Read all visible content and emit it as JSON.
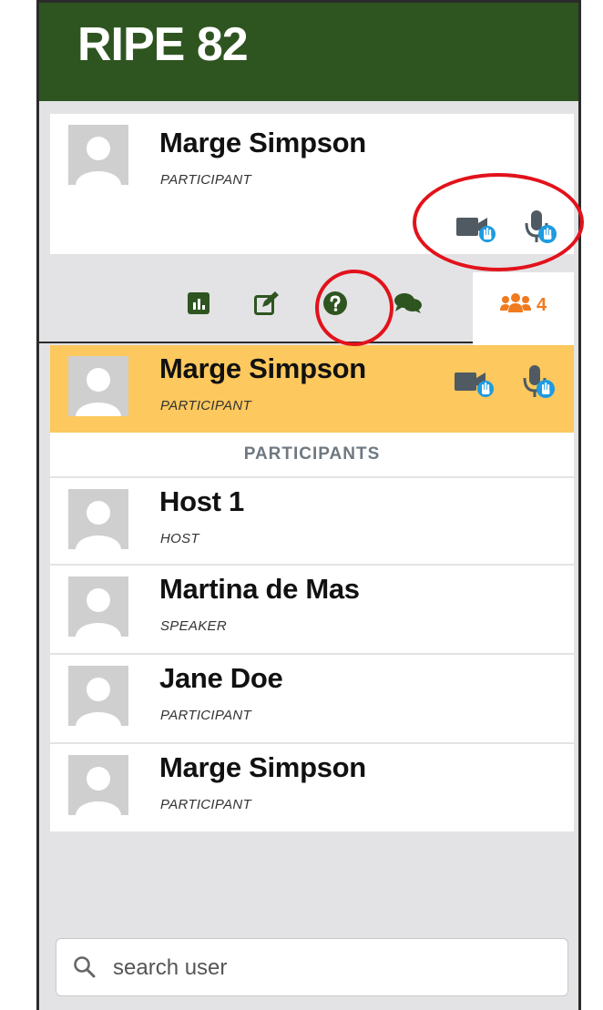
{
  "app": {
    "title": "RIPE 82"
  },
  "current_user": {
    "name": "Marge Simpson",
    "role": "PARTICIPANT"
  },
  "tabs": [
    {
      "icon": "poll-icon"
    },
    {
      "icon": "edit-icon"
    },
    {
      "icon": "question-icon"
    },
    {
      "icon": "chat-icon"
    },
    {
      "icon": "users-icon",
      "count": "4",
      "active": true
    }
  ],
  "highlighted_user": {
    "name": "Marge Simpson",
    "role": "PARTICIPANT"
  },
  "section_title": "PARTICIPANTS",
  "participants": [
    {
      "name": "Host 1",
      "role": "HOST"
    },
    {
      "name": "Martina de Mas",
      "role": "SPEAKER"
    },
    {
      "name": "Jane Doe",
      "role": "PARTICIPANT"
    },
    {
      "name": "Marge Simpson",
      "role": "PARTICIPANT"
    }
  ],
  "search": {
    "placeholder": "search user"
  },
  "colors": {
    "header": "#2e5520",
    "accent_orange": "#f07a1e",
    "highlight": "#fdc85d",
    "hand": "#1e9be0",
    "annotation": "#e2121b"
  }
}
